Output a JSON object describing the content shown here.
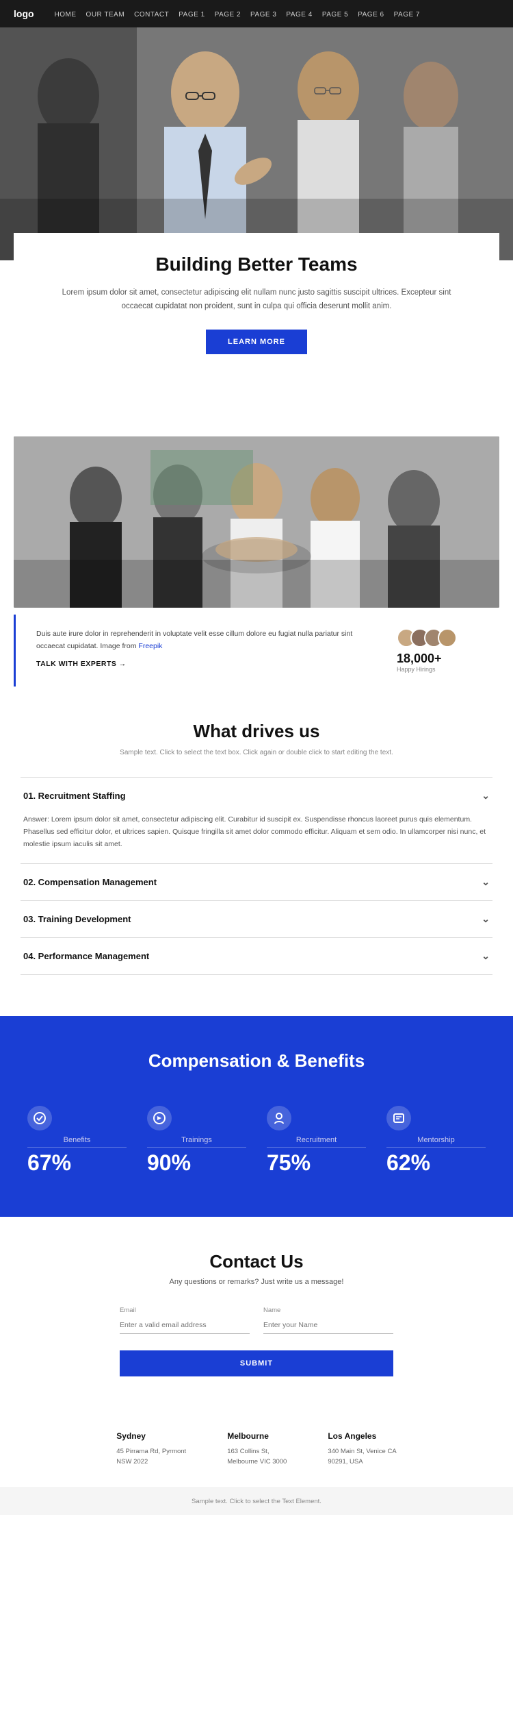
{
  "nav": {
    "logo": "logo",
    "links": [
      {
        "label": "HOME",
        "id": "home"
      },
      {
        "label": "OUR TEAM",
        "id": "our-team"
      },
      {
        "label": "CONTACT",
        "id": "contact"
      },
      {
        "label": "PAGE 1",
        "id": "page1"
      },
      {
        "label": "PAGE 2",
        "id": "page2"
      },
      {
        "label": "PAGE 3",
        "id": "page3"
      },
      {
        "label": "PAGE 4",
        "id": "page4"
      },
      {
        "label": "PAGE 5",
        "id": "page5"
      },
      {
        "label": "PAGE 6",
        "id": "page6"
      },
      {
        "label": "PAGE 7",
        "id": "page7"
      }
    ]
  },
  "intro": {
    "heading": "Building Better Teams",
    "body": "Lorem ipsum dolor sit amet, consectetur adipiscing elit nullam nunc justo sagittis suscipit ultrices. Excepteur sint occaecat cupidatat non proident, sunt in culpa qui officia deserunt mollit anim.",
    "btn_label": "LEARN MORE"
  },
  "about": {
    "text": "Duis aute irure dolor in reprehenderit in voluptate velit esse cillum dolore eu fugiat nulla pariatur sint occaecat cupidatat. Image from ",
    "freepik_link": "Freepik",
    "talk_link": "TALK WITH EXPERTS →",
    "happy_count": "18,000+",
    "happy_label": "Happy Hirings"
  },
  "drives": {
    "heading": "What drives us",
    "subtitle": "Sample text. Click to select the text box. Click again or double click to start editing the text.",
    "accordion": [
      {
        "id": "acc1",
        "title": "01. Recruitment Staffing",
        "open": true,
        "body": "Answer: Lorem ipsum dolor sit amet, consectetur adipiscing elit. Curabitur id suscipit ex. Suspendisse rhoncus laoreet purus quis elementum. Phasellus sed efficitur dolor, et ultrices sapien. Quisque fringilla sit amet dolor commodo efficitur. Aliquam et sem odio. In ullamcorper nisi nunc, et molestie ipsum iaculis sit amet."
      },
      {
        "id": "acc2",
        "title": "02. Compensation Management",
        "open": false,
        "body": ""
      },
      {
        "id": "acc3",
        "title": "03. Training Development",
        "open": false,
        "body": ""
      },
      {
        "id": "acc4",
        "title": "04. Performance Management",
        "open": false,
        "body": ""
      }
    ]
  },
  "compensation": {
    "heading": "Compensation & Benefits",
    "items": [
      {
        "icon": "🛡",
        "label": "Benefits",
        "value": "67%"
      },
      {
        "icon": "🏆",
        "label": "Trainings",
        "value": "90%"
      },
      {
        "icon": "👤",
        "label": "Recruitment",
        "value": "75%"
      },
      {
        "icon": "📋",
        "label": "Mentorship",
        "value": "62%"
      }
    ]
  },
  "contact": {
    "heading": "Contact Us",
    "subtitle": "Any questions or remarks? Just write us a message!",
    "email_label": "Email",
    "email_placeholder": "Enter a valid email address",
    "name_label": "Name",
    "name_placeholder": "Enter your Name",
    "submit_label": "SUBMIT",
    "offices": [
      {
        "city": "Sydney",
        "address": "45 Pirrama Rd, Pyrmont",
        "address2": "NSW 2022"
      },
      {
        "city": "Melbourne",
        "address": "163 Collins St,",
        "address2": "Melbourne VIC 3000"
      },
      {
        "city": "Los Angeles",
        "address": "340 Main St, Venice CA",
        "address2": "90291, USA"
      }
    ]
  },
  "footer": {
    "text": "Sample text. Click to select the Text Element."
  }
}
